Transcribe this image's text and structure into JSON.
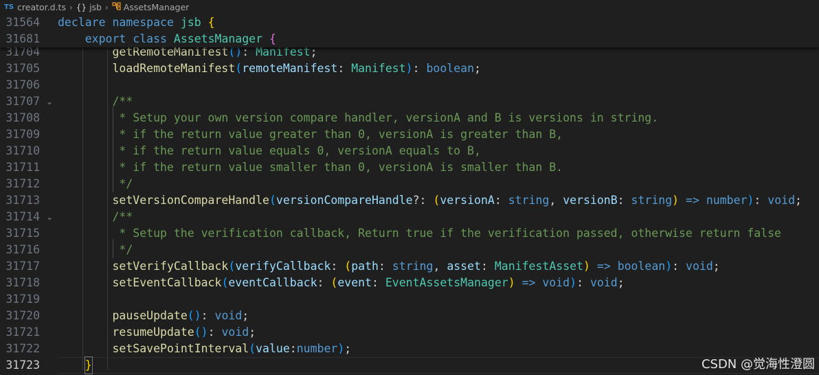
{
  "breadcrumb": {
    "file_icon": "TS",
    "file": "creator.d.ts",
    "ns_icon": "{}",
    "namespace": "jsb",
    "class_icon": "class-icon",
    "class": "AssetsManager",
    "separator": "›"
  },
  "sticky_lines": [
    {
      "ln": "31564",
      "tokens": [
        [
          "kw",
          "declare"
        ],
        [
          "pu",
          " "
        ],
        [
          "kw",
          "namespace"
        ],
        [
          "pu",
          " "
        ],
        [
          "ns",
          "jsb"
        ],
        [
          "pu",
          " "
        ],
        [
          "b1",
          "{"
        ]
      ]
    },
    {
      "ln": "31681",
      "tokens": [
        [
          "pu",
          "    "
        ],
        [
          "kw",
          "export"
        ],
        [
          "pu",
          " "
        ],
        [
          "kw",
          "class"
        ],
        [
          "pu",
          " "
        ],
        [
          "ty",
          "AssetsManager"
        ],
        [
          "pu",
          " "
        ],
        [
          "b2",
          "{"
        ]
      ]
    }
  ],
  "lines": [
    {
      "ln": "31704",
      "fold": "",
      "tokens": [
        [
          "pu",
          "        "
        ],
        [
          "fn",
          "getRemoteManifest"
        ],
        [
          "b3",
          "()"
        ],
        [
          "pu",
          ": "
        ],
        [
          "ty",
          "Manifest"
        ],
        [
          "pu",
          ";"
        ]
      ]
    },
    {
      "ln": "31705",
      "fold": "",
      "tokens": [
        [
          "pu",
          "        "
        ],
        [
          "fn",
          "loadRemoteManifest"
        ],
        [
          "b3",
          "("
        ],
        [
          "pm",
          "remoteManifest"
        ],
        [
          "pu",
          ": "
        ],
        [
          "ty",
          "Manifest"
        ],
        [
          "b3",
          ")"
        ],
        [
          "pu",
          ": "
        ],
        [
          "kw",
          "boolean"
        ],
        [
          "pu",
          ";"
        ]
      ]
    },
    {
      "ln": "31706",
      "fold": "",
      "tokens": []
    },
    {
      "ln": "31707",
      "fold": "⌄",
      "tokens": [
        [
          "pu",
          "        "
        ],
        [
          "cm",
          "/**"
        ]
      ]
    },
    {
      "ln": "31708",
      "fold": "",
      "tokens": [
        [
          "pu",
          "         "
        ],
        [
          "cm",
          "* Setup your own version compare handler, versionA and B is versions in string."
        ]
      ]
    },
    {
      "ln": "31709",
      "fold": "",
      "tokens": [
        [
          "pu",
          "         "
        ],
        [
          "cm",
          "* if the return value greater than 0, versionA is greater than B,"
        ]
      ]
    },
    {
      "ln": "31710",
      "fold": "",
      "tokens": [
        [
          "pu",
          "         "
        ],
        [
          "cm",
          "* if the return value equals 0, versionA equals to B,"
        ]
      ]
    },
    {
      "ln": "31711",
      "fold": "",
      "tokens": [
        [
          "pu",
          "         "
        ],
        [
          "cm",
          "* if the return value smaller than 0, versionA is smaller than B."
        ]
      ]
    },
    {
      "ln": "31712",
      "fold": "",
      "tokens": [
        [
          "pu",
          "         "
        ],
        [
          "cm",
          "*/"
        ]
      ]
    },
    {
      "ln": "31713",
      "fold": "",
      "tokens": [
        [
          "pu",
          "        "
        ],
        [
          "fn",
          "setVersionCompareHandle"
        ],
        [
          "b3",
          "("
        ],
        [
          "pm",
          "versionCompareHandle"
        ],
        [
          "pu",
          "?: "
        ],
        [
          "b1",
          "("
        ],
        [
          "pm",
          "versionA"
        ],
        [
          "pu",
          ": "
        ],
        [
          "kw",
          "string"
        ],
        [
          "pu",
          ", "
        ],
        [
          "pm",
          "versionB"
        ],
        [
          "pu",
          ": "
        ],
        [
          "kw",
          "string"
        ],
        [
          "b1",
          ")"
        ],
        [
          "pu",
          " "
        ],
        [
          "ar",
          "=>"
        ],
        [
          "pu",
          " "
        ],
        [
          "kw",
          "number"
        ],
        [
          "b3",
          ")"
        ],
        [
          "pu",
          ": "
        ],
        [
          "kw",
          "void"
        ],
        [
          "pu",
          ";"
        ]
      ]
    },
    {
      "ln": "31714",
      "fold": "⌄",
      "tokens": [
        [
          "pu",
          "        "
        ],
        [
          "cm",
          "/**"
        ]
      ]
    },
    {
      "ln": "31715",
      "fold": "",
      "tokens": [
        [
          "pu",
          "         "
        ],
        [
          "cm",
          "* Setup the verification callback, Return true if the verification passed, otherwise return false"
        ]
      ]
    },
    {
      "ln": "31716",
      "fold": "",
      "tokens": [
        [
          "pu",
          "         "
        ],
        [
          "cm",
          "*/"
        ]
      ]
    },
    {
      "ln": "31717",
      "fold": "",
      "tokens": [
        [
          "pu",
          "        "
        ],
        [
          "fn",
          "setVerifyCallback"
        ],
        [
          "b3",
          "("
        ],
        [
          "pm",
          "verifyCallback"
        ],
        [
          "pu",
          ": "
        ],
        [
          "b1",
          "("
        ],
        [
          "pm",
          "path"
        ],
        [
          "pu",
          ": "
        ],
        [
          "kw",
          "string"
        ],
        [
          "pu",
          ", "
        ],
        [
          "pm",
          "asset"
        ],
        [
          "pu",
          ": "
        ],
        [
          "ty",
          "ManifestAsset"
        ],
        [
          "b1",
          ")"
        ],
        [
          "pu",
          " "
        ],
        [
          "ar",
          "=>"
        ],
        [
          "pu",
          " "
        ],
        [
          "kw",
          "boolean"
        ],
        [
          "b3",
          ")"
        ],
        [
          "pu",
          ": "
        ],
        [
          "kw",
          "void"
        ],
        [
          "pu",
          ";"
        ]
      ]
    },
    {
      "ln": "31718",
      "fold": "",
      "tokens": [
        [
          "pu",
          "        "
        ],
        [
          "fn",
          "setEventCallback"
        ],
        [
          "b3",
          "("
        ],
        [
          "pm",
          "eventCallback"
        ],
        [
          "pu",
          ": "
        ],
        [
          "b1",
          "("
        ],
        [
          "pm",
          "event"
        ],
        [
          "pu",
          ": "
        ],
        [
          "ty",
          "EventAssetsManager"
        ],
        [
          "b1",
          ")"
        ],
        [
          "pu",
          " "
        ],
        [
          "ar",
          "=>"
        ],
        [
          "pu",
          " "
        ],
        [
          "kw",
          "void"
        ],
        [
          "b3",
          ")"
        ],
        [
          "pu",
          ": "
        ],
        [
          "kw",
          "void"
        ],
        [
          "pu",
          ";"
        ]
      ]
    },
    {
      "ln": "31719",
      "fold": "",
      "tokens": []
    },
    {
      "ln": "31720",
      "fold": "",
      "tokens": [
        [
          "pu",
          "        "
        ],
        [
          "fn",
          "pauseUpdate"
        ],
        [
          "b3",
          "()"
        ],
        [
          "pu",
          ": "
        ],
        [
          "kw",
          "void"
        ],
        [
          "pu",
          ";"
        ]
      ]
    },
    {
      "ln": "31721",
      "fold": "",
      "tokens": [
        [
          "pu",
          "        "
        ],
        [
          "fn",
          "resumeUpdate"
        ],
        [
          "b3",
          "()"
        ],
        [
          "pu",
          ": "
        ],
        [
          "kw",
          "void"
        ],
        [
          "pu",
          ";"
        ]
      ]
    },
    {
      "ln": "31722",
      "fold": "",
      "tokens": [
        [
          "pu",
          "        "
        ],
        [
          "fn",
          "setSavePointInterval"
        ],
        [
          "b3",
          "("
        ],
        [
          "pm",
          "value"
        ],
        [
          "pu",
          ":"
        ],
        [
          "kw",
          "number"
        ],
        [
          "b3",
          ")"
        ],
        [
          "pu",
          ";"
        ]
      ]
    },
    {
      "ln": "31723",
      "fold": "",
      "active": true,
      "tokens": [
        [
          "pu",
          "    "
        ],
        [
          "box",
          "}"
        ]
      ]
    }
  ],
  "watermark": "CSDN @觉海性澄圆"
}
